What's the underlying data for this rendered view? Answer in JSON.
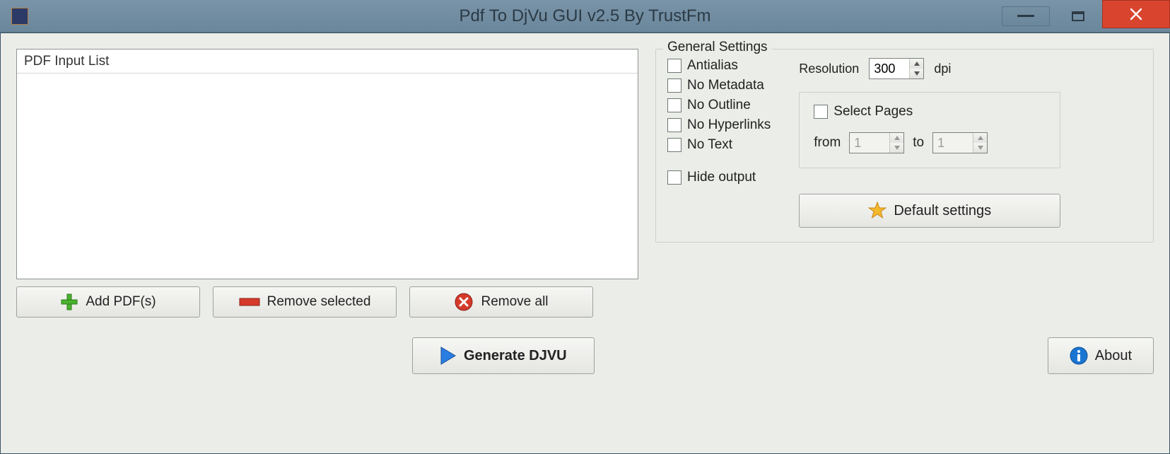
{
  "window": {
    "title": "Pdf To DjVu GUI v2.5 By TrustFm"
  },
  "leftPanel": {
    "listHeader": "PDF Input List",
    "buttons": {
      "add": "Add PDF(s)",
      "removeSelected": "Remove selected",
      "removeAll": "Remove all"
    }
  },
  "settings": {
    "legend": "General Settings",
    "checks": {
      "antialias": "Antialias",
      "noMetadata": "No Metadata",
      "noOutline": "No Outline",
      "noHyperlinks": "No Hyperlinks",
      "noText": "No Text",
      "hideOutput": "Hide output"
    },
    "resolution": {
      "label": "Resolution",
      "value": "300",
      "unit": "dpi"
    },
    "pages": {
      "selectLabel": "Select Pages",
      "fromLabel": "from",
      "fromValue": "1",
      "toLabel": "to",
      "toValue": "1"
    },
    "defaultBtn": "Default settings"
  },
  "bottom": {
    "generate": "Generate DJVU",
    "about": "About"
  }
}
